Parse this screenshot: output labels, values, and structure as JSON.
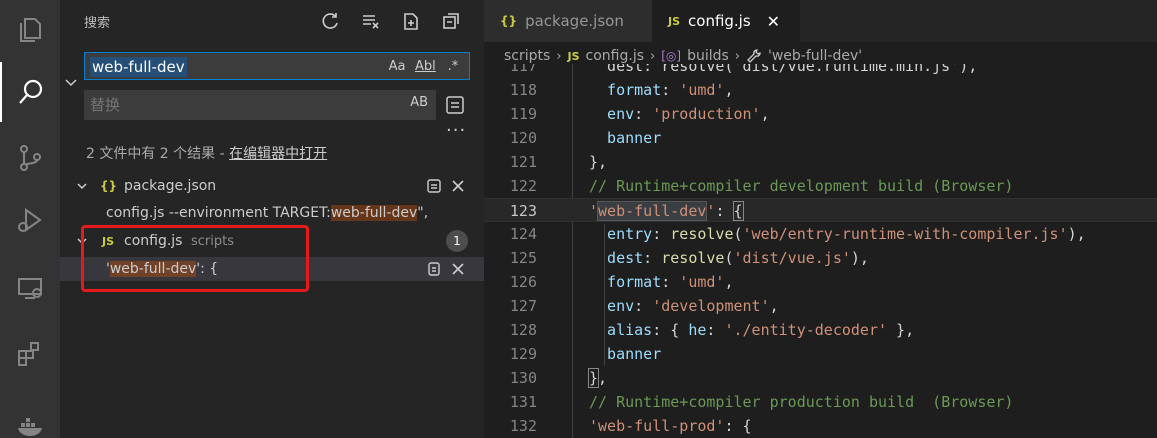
{
  "sidebar": {
    "title": "搜索",
    "search_value": "web-full-dev",
    "search_opts": [
      "Aa",
      "Abl",
      ".*"
    ],
    "replace_placeholder": "替换",
    "replace_opt": "AB",
    "more": "···",
    "summary_prefix": "2 文件中有 2 个结果 - ",
    "summary_link": "在编辑器中打开",
    "results": [
      {
        "file_icon": "{}",
        "file": "package.json",
        "matches": [
          {
            "before": "config.js --environment TARGET:",
            "match": "web-full-dev",
            "after": "\","
          }
        ]
      },
      {
        "file_icon": "JS",
        "file": "config.js",
        "path": "scripts",
        "count": "1",
        "matches": [
          {
            "before": "'",
            "match": "web-full-dev",
            "after": "': {"
          }
        ]
      }
    ]
  },
  "tabs": [
    {
      "icon": "{}",
      "label": "package.json",
      "active": false
    },
    {
      "icon": "JS",
      "label": "config.js",
      "active": true,
      "close": "✕"
    }
  ],
  "breadcrumb": {
    "items": [
      "scripts",
      "config.js",
      "builds",
      "'web-full-dev'"
    ],
    "icons": [
      "",
      "JS",
      "[◎]",
      "wrench-icon"
    ]
  },
  "code": {
    "current_line": 123,
    "lines": [
      {
        "n": "117",
        "tokens": [
          {
            "t": "dest: resolve('dist/vue.runtime.min.js'),",
            "c": "t-pun"
          }
        ]
      },
      {
        "n": "118",
        "tokens": [
          {
            "t": "format",
            "c": "t-prop"
          },
          {
            "t": ": ",
            "c": "t-pun"
          },
          {
            "t": "'umd'",
            "c": "t-str"
          },
          {
            "t": ",",
            "c": "t-pun"
          }
        ]
      },
      {
        "n": "119",
        "tokens": [
          {
            "t": "env",
            "c": "t-prop"
          },
          {
            "t": ": ",
            "c": "t-pun"
          },
          {
            "t": "'production'",
            "c": "t-str"
          },
          {
            "t": ",",
            "c": "t-pun"
          }
        ]
      },
      {
        "n": "120",
        "tokens": [
          {
            "t": "banner",
            "c": "t-prop"
          }
        ]
      },
      {
        "n": "121",
        "tokens": [
          {
            "t": "},",
            "c": "t-pun"
          }
        ]
      },
      {
        "n": "122",
        "tokens": [
          {
            "t": "// Runtime+compiler development build (Browser)",
            "c": "t-com"
          }
        ]
      },
      {
        "n": "123",
        "tokens": [
          {
            "t": "'",
            "c": "t-str"
          },
          {
            "t": "web-full-dev",
            "c": "t-str t-hl"
          },
          {
            "t": "'",
            "c": "t-str"
          },
          {
            "t": ": ",
            "c": "t-pun"
          },
          {
            "t": "{",
            "c": "t-pun t-br"
          }
        ]
      },
      {
        "n": "124",
        "tokens": [
          {
            "t": "entry",
            "c": "t-prop"
          },
          {
            "t": ": ",
            "c": "t-pun"
          },
          {
            "t": "resolve",
            "c": "t-fn"
          },
          {
            "t": "(",
            "c": "t-pun"
          },
          {
            "t": "'web/entry-runtime-with-compiler.js'",
            "c": "t-str"
          },
          {
            "t": "),",
            "c": "t-pun"
          }
        ]
      },
      {
        "n": "125",
        "tokens": [
          {
            "t": "dest",
            "c": "t-prop"
          },
          {
            "t": ": ",
            "c": "t-pun"
          },
          {
            "t": "resolve",
            "c": "t-fn"
          },
          {
            "t": "(",
            "c": "t-pun"
          },
          {
            "t": "'dist/vue.js'",
            "c": "t-str"
          },
          {
            "t": "),",
            "c": "t-pun"
          }
        ]
      },
      {
        "n": "126",
        "tokens": [
          {
            "t": "format",
            "c": "t-prop"
          },
          {
            "t": ": ",
            "c": "t-pun"
          },
          {
            "t": "'umd'",
            "c": "t-str"
          },
          {
            "t": ",",
            "c": "t-pun"
          }
        ]
      },
      {
        "n": "127",
        "tokens": [
          {
            "t": "env",
            "c": "t-prop"
          },
          {
            "t": ": ",
            "c": "t-pun"
          },
          {
            "t": "'development'",
            "c": "t-str"
          },
          {
            "t": ",",
            "c": "t-pun"
          }
        ]
      },
      {
        "n": "128",
        "tokens": [
          {
            "t": "alias",
            "c": "t-prop"
          },
          {
            "t": ": { ",
            "c": "t-pun"
          },
          {
            "t": "he",
            "c": "t-prop"
          },
          {
            "t": ": ",
            "c": "t-pun"
          },
          {
            "t": "'./entity-decoder'",
            "c": "t-str"
          },
          {
            "t": " },",
            "c": "t-pun"
          }
        ]
      },
      {
        "n": "129",
        "tokens": [
          {
            "t": "banner",
            "c": "t-prop"
          }
        ]
      },
      {
        "n": "130",
        "tokens": [
          {
            "t": "}",
            "c": "t-pun t-br"
          },
          {
            "t": ",",
            "c": "t-pun"
          }
        ]
      },
      {
        "n": "131",
        "tokens": [
          {
            "t": "// Runtime+compiler production build  (Browser)",
            "c": "t-com"
          }
        ]
      },
      {
        "n": "132",
        "tokens": [
          {
            "t": "'web-full-prod'",
            "c": "t-str"
          },
          {
            "t": ": {",
            "c": "t-pun"
          }
        ]
      }
    ]
  },
  "colors": {
    "highlight_box": "#e51b1b",
    "accent": "#007fd4"
  }
}
